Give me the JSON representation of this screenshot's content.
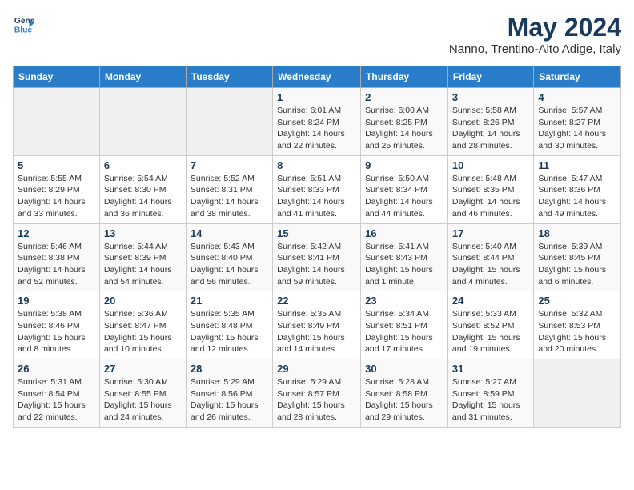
{
  "header": {
    "logo_line1": "General",
    "logo_line2": "Blue",
    "main_title": "May 2024",
    "subtitle": "Nanno, Trentino-Alto Adige, Italy"
  },
  "days_of_week": [
    "Sunday",
    "Monday",
    "Tuesday",
    "Wednesday",
    "Thursday",
    "Friday",
    "Saturday"
  ],
  "weeks": [
    [
      {
        "day": "",
        "info": ""
      },
      {
        "day": "",
        "info": ""
      },
      {
        "day": "",
        "info": ""
      },
      {
        "day": "1",
        "info": "Sunrise: 6:01 AM\nSunset: 8:24 PM\nDaylight: 14 hours\nand 22 minutes."
      },
      {
        "day": "2",
        "info": "Sunrise: 6:00 AM\nSunset: 8:25 PM\nDaylight: 14 hours\nand 25 minutes."
      },
      {
        "day": "3",
        "info": "Sunrise: 5:58 AM\nSunset: 8:26 PM\nDaylight: 14 hours\nand 28 minutes."
      },
      {
        "day": "4",
        "info": "Sunrise: 5:57 AM\nSunset: 8:27 PM\nDaylight: 14 hours\nand 30 minutes."
      }
    ],
    [
      {
        "day": "5",
        "info": "Sunrise: 5:55 AM\nSunset: 8:29 PM\nDaylight: 14 hours\nand 33 minutes."
      },
      {
        "day": "6",
        "info": "Sunrise: 5:54 AM\nSunset: 8:30 PM\nDaylight: 14 hours\nand 36 minutes."
      },
      {
        "day": "7",
        "info": "Sunrise: 5:52 AM\nSunset: 8:31 PM\nDaylight: 14 hours\nand 38 minutes."
      },
      {
        "day": "8",
        "info": "Sunrise: 5:51 AM\nSunset: 8:33 PM\nDaylight: 14 hours\nand 41 minutes."
      },
      {
        "day": "9",
        "info": "Sunrise: 5:50 AM\nSunset: 8:34 PM\nDaylight: 14 hours\nand 44 minutes."
      },
      {
        "day": "10",
        "info": "Sunrise: 5:48 AM\nSunset: 8:35 PM\nDaylight: 14 hours\nand 46 minutes."
      },
      {
        "day": "11",
        "info": "Sunrise: 5:47 AM\nSunset: 8:36 PM\nDaylight: 14 hours\nand 49 minutes."
      }
    ],
    [
      {
        "day": "12",
        "info": "Sunrise: 5:46 AM\nSunset: 8:38 PM\nDaylight: 14 hours\nand 52 minutes."
      },
      {
        "day": "13",
        "info": "Sunrise: 5:44 AM\nSunset: 8:39 PM\nDaylight: 14 hours\nand 54 minutes."
      },
      {
        "day": "14",
        "info": "Sunrise: 5:43 AM\nSunset: 8:40 PM\nDaylight: 14 hours\nand 56 minutes."
      },
      {
        "day": "15",
        "info": "Sunrise: 5:42 AM\nSunset: 8:41 PM\nDaylight: 14 hours\nand 59 minutes."
      },
      {
        "day": "16",
        "info": "Sunrise: 5:41 AM\nSunset: 8:43 PM\nDaylight: 15 hours\nand 1 minute."
      },
      {
        "day": "17",
        "info": "Sunrise: 5:40 AM\nSunset: 8:44 PM\nDaylight: 15 hours\nand 4 minutes."
      },
      {
        "day": "18",
        "info": "Sunrise: 5:39 AM\nSunset: 8:45 PM\nDaylight: 15 hours\nand 6 minutes."
      }
    ],
    [
      {
        "day": "19",
        "info": "Sunrise: 5:38 AM\nSunset: 8:46 PM\nDaylight: 15 hours\nand 8 minutes."
      },
      {
        "day": "20",
        "info": "Sunrise: 5:36 AM\nSunset: 8:47 PM\nDaylight: 15 hours\nand 10 minutes."
      },
      {
        "day": "21",
        "info": "Sunrise: 5:35 AM\nSunset: 8:48 PM\nDaylight: 15 hours\nand 12 minutes."
      },
      {
        "day": "22",
        "info": "Sunrise: 5:35 AM\nSunset: 8:49 PM\nDaylight: 15 hours\nand 14 minutes."
      },
      {
        "day": "23",
        "info": "Sunrise: 5:34 AM\nSunset: 8:51 PM\nDaylight: 15 hours\nand 17 minutes."
      },
      {
        "day": "24",
        "info": "Sunrise: 5:33 AM\nSunset: 8:52 PM\nDaylight: 15 hours\nand 19 minutes."
      },
      {
        "day": "25",
        "info": "Sunrise: 5:32 AM\nSunset: 8:53 PM\nDaylight: 15 hours\nand 20 minutes."
      }
    ],
    [
      {
        "day": "26",
        "info": "Sunrise: 5:31 AM\nSunset: 8:54 PM\nDaylight: 15 hours\nand 22 minutes."
      },
      {
        "day": "27",
        "info": "Sunrise: 5:30 AM\nSunset: 8:55 PM\nDaylight: 15 hours\nand 24 minutes."
      },
      {
        "day": "28",
        "info": "Sunrise: 5:29 AM\nSunset: 8:56 PM\nDaylight: 15 hours\nand 26 minutes."
      },
      {
        "day": "29",
        "info": "Sunrise: 5:29 AM\nSunset: 8:57 PM\nDaylight: 15 hours\nand 28 minutes."
      },
      {
        "day": "30",
        "info": "Sunrise: 5:28 AM\nSunset: 8:58 PM\nDaylight: 15 hours\nand 29 minutes."
      },
      {
        "day": "31",
        "info": "Sunrise: 5:27 AM\nSunset: 8:59 PM\nDaylight: 15 hours\nand 31 minutes."
      },
      {
        "day": "",
        "info": ""
      }
    ]
  ]
}
